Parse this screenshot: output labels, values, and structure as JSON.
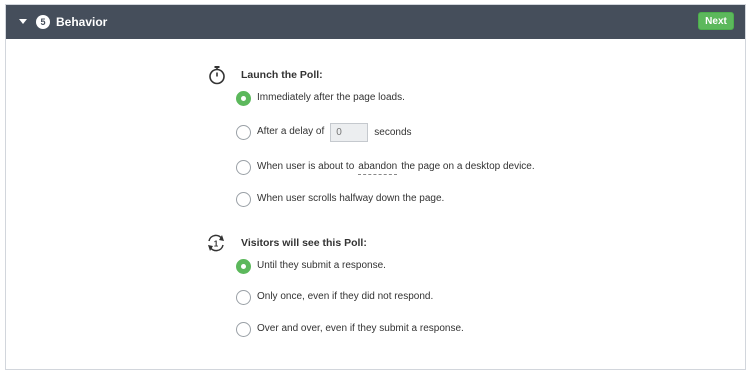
{
  "header": {
    "step_number": "5",
    "title": "Behavior",
    "next_label": "Next"
  },
  "launch": {
    "title": "Launch the Poll:",
    "icon": "stopwatch-icon",
    "options": [
      {
        "label": "Immediately after the page loads.",
        "checked": true
      },
      {
        "label_before": "After a delay of",
        "input_placeholder": "0",
        "label_after": "seconds",
        "checked": false
      },
      {
        "label_before": "When user is about to",
        "label_link": "abandon",
        "label_after": "the page on a desktop device.",
        "checked": false
      },
      {
        "label": "When user scrolls halfway down the page.",
        "checked": false
      }
    ]
  },
  "visitors": {
    "title": "Visitors will see this Poll:",
    "icon": "repeat-once-icon",
    "icon_text": "1",
    "options": [
      {
        "label": "Until they submit a response.",
        "checked": true
      },
      {
        "label": "Only once, even if they did not respond.",
        "checked": false
      },
      {
        "label": "Over and over, even if they submit a response.",
        "checked": false
      }
    ]
  },
  "colors": {
    "header_bg": "#454e5b",
    "accent_green": "#5cb85c"
  }
}
